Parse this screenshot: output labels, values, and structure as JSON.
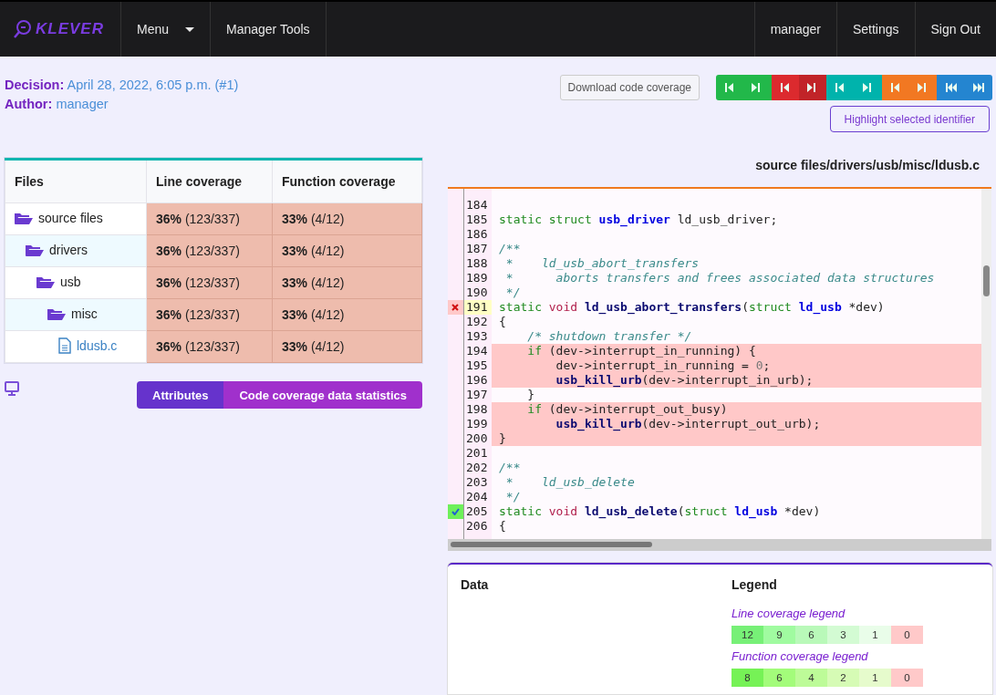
{
  "navbar": {
    "logo": "KLEVER",
    "items": [
      {
        "label": "Menu",
        "dropdown": true
      },
      {
        "label": "Manager Tools",
        "dropdown": false
      }
    ],
    "right_items": [
      "manager",
      "Settings",
      "Sign Out"
    ]
  },
  "decision": {
    "label": "Decision:",
    "value": "April 28, 2022, 6:05 p.m. (#1)"
  },
  "author": {
    "label": "Author:",
    "value": "manager"
  },
  "download_button": "Download code coverage",
  "nav_buttons": [
    {
      "kind": "prev",
      "color": "#22b84a",
      "hovered": false
    },
    {
      "kind": "next",
      "color": "#22b84a",
      "hovered": false
    },
    {
      "kind": "prev",
      "color": "#dc2a2e",
      "hovered": false
    },
    {
      "kind": "next",
      "color": "#dc2a2e",
      "hovered": true
    },
    {
      "kind": "prev",
      "color": "#00b3ac",
      "hovered": false
    },
    {
      "kind": "next",
      "color": "#00b3ac",
      "hovered": false
    },
    {
      "kind": "prev",
      "color": "#f27822",
      "hovered": false
    },
    {
      "kind": "next",
      "color": "#f27822",
      "hovered": false
    },
    {
      "kind": "first",
      "color": "#2485d0",
      "hovered": false
    },
    {
      "kind": "last",
      "color": "#2485d0",
      "hovered": false
    }
  ],
  "highlight_button": "Highlight selected identifier",
  "files_table": {
    "columns": [
      "Files",
      "Line coverage",
      "Function coverage"
    ],
    "rows": [
      {
        "name": "source files",
        "kind": "folder",
        "line_coverage": "**36%** (123/337)",
        "function_coverage": "**33%** (4/12)",
        "children": [
          {
            "name": "drivers",
            "kind": "folder",
            "line_coverage": "**36%** (123/337)",
            "function_coverage": "**33%** (4/12)",
            "children": [
              {
                "name": "usb",
                "kind": "folder",
                "line_coverage": "**36%** (123/337)",
                "function_coverage": "**33%** (4/12)",
                "children": [
                  {
                    "name": "misc",
                    "kind": "folder",
                    "line_coverage": "**36%** (123/337)",
                    "function_coverage": "**33%** (4/12)",
                    "children": [
                      {
                        "name": "ldusb.c",
                        "kind": "file",
                        "line_coverage": "**36%** (123/337)",
                        "function_coverage": "**33%** (4/12)"
                      }
                    ]
                  }
                ]
              }
            ]
          }
        ]
      }
    ]
  },
  "view_buttons": [
    {
      "label": "Attributes",
      "color": "#6633cc"
    },
    {
      "label": "Code coverage data statistics",
      "color": "#a030cc"
    }
  ],
  "file_path": "source files/drivers/usb/misc/ldusb.c",
  "code": {
    "lines": [
      {
        "number": "184",
        "uncovered": false,
        "selected": false
      },
      {
        "number": "185",
        "uncovered": false,
        "selected": false,
        "tokens": [
          {
            "kind": "kw",
            "text": "static"
          },
          {
            "kind": "kw",
            "text": " struct"
          },
          {
            "kind": "id",
            "text": " usb_driver"
          },
          {
            "kind": "plain",
            "text": " ld_usb_driver;"
          }
        ]
      },
      {
        "number": "186",
        "uncovered": false,
        "selected": false
      },
      {
        "number": "187",
        "uncovered": false,
        "selected": false,
        "tokens": [
          {
            "kind": "comment",
            "text": "/**"
          }
        ]
      },
      {
        "number": "188",
        "uncovered": false,
        "selected": false,
        "tokens": [
          {
            "kind": "comment",
            "text": " *    ld_usb_abort_transfers"
          }
        ]
      },
      {
        "number": "189",
        "uncovered": false,
        "selected": false,
        "tokens": [
          {
            "kind": "comment",
            "text": " *      aborts transfers and frees associated data structures"
          }
        ]
      },
      {
        "number": "190",
        "uncovered": false,
        "selected": false,
        "tokens": [
          {
            "kind": "comment",
            "text": " */"
          }
        ]
      },
      {
        "number": "191",
        "uncovered": false,
        "selected": true,
        "function_hit": false,
        "tokens": [
          {
            "kind": "kw",
            "text": "static"
          },
          {
            "kind": "type",
            "text": " void"
          },
          {
            "kind": "func",
            "text": " ld_usb_abort_transfers"
          },
          {
            "kind": "plain",
            "text": "("
          },
          {
            "kind": "kw",
            "text": "struct"
          },
          {
            "kind": "id",
            "text": " ld_usb"
          },
          {
            "kind": "plain",
            "text": " *dev)"
          }
        ]
      },
      {
        "number": "192",
        "uncovered": false,
        "selected": false,
        "tokens": [
          {
            "kind": "plain",
            "text": "{"
          }
        ]
      },
      {
        "number": "193",
        "uncovered": false,
        "selected": false,
        "tokens": [
          {
            "kind": "comment",
            "text": "    /* shutdown transfer */"
          }
        ]
      },
      {
        "number": "194",
        "uncovered": true,
        "selected": false,
        "tokens": [
          {
            "kind": "kw",
            "text": "    if"
          },
          {
            "kind": "plain",
            "text": " (dev->interrupt_in_running) {"
          }
        ]
      },
      {
        "number": "195",
        "uncovered": true,
        "selected": false,
        "tokens": [
          {
            "kind": "plain",
            "text": "        dev->interrupt_in_running = "
          },
          {
            "kind": "num",
            "text": "0"
          },
          {
            "kind": "plain",
            "text": ";"
          }
        ]
      },
      {
        "number": "196",
        "uncovered": true,
        "selected": false,
        "tokens": [
          {
            "kind": "func",
            "text": "        usb_kill_urb"
          },
          {
            "kind": "plain",
            "text": "(dev->interrupt_in_urb);"
          }
        ]
      },
      {
        "number": "197",
        "uncovered": false,
        "selected": false,
        "tokens": [
          {
            "kind": "plain",
            "text": "    }"
          }
        ]
      },
      {
        "number": "198",
        "uncovered": true,
        "selected": false,
        "tokens": [
          {
            "kind": "kw",
            "text": "    if"
          },
          {
            "kind": "plain",
            "text": " (dev->interrupt_out_busy)"
          }
        ]
      },
      {
        "number": "199",
        "uncovered": true,
        "selected": false,
        "tokens": [
          {
            "kind": "func",
            "text": "        usb_kill_urb"
          },
          {
            "kind": "plain",
            "text": "(dev->interrupt_out_urb);"
          }
        ]
      },
      {
        "number": "200",
        "uncovered": true,
        "selected": false,
        "tokens": [
          {
            "kind": "plain",
            "text": "}"
          }
        ]
      },
      {
        "number": "201",
        "uncovered": false,
        "selected": false
      },
      {
        "number": "202",
        "uncovered": false,
        "selected": false,
        "tokens": [
          {
            "kind": "comment",
            "text": "/**"
          }
        ]
      },
      {
        "number": "203",
        "uncovered": false,
        "selected": false,
        "tokens": [
          {
            "kind": "comment",
            "text": " *    ld_usb_delete"
          }
        ]
      },
      {
        "number": "204",
        "uncovered": false,
        "selected": false,
        "tokens": [
          {
            "kind": "comment",
            "text": " */"
          }
        ]
      },
      {
        "number": "205",
        "uncovered": false,
        "selected": false,
        "function_hit": true,
        "tokens": [
          {
            "kind": "kw",
            "text": "static"
          },
          {
            "kind": "type",
            "text": " void"
          },
          {
            "kind": "func",
            "text": " ld_usb_delete"
          },
          {
            "kind": "plain",
            "text": "("
          },
          {
            "kind": "kw",
            "text": "struct"
          },
          {
            "kind": "id",
            "text": " ld_usb"
          },
          {
            "kind": "plain",
            "text": " *dev)"
          }
        ]
      },
      {
        "number": "206",
        "uncovered": false,
        "selected": false,
        "tokens": [
          {
            "kind": "plain",
            "text": "{"
          }
        ]
      }
    ]
  },
  "data_panel": {
    "title": "Data"
  },
  "legend": {
    "title": "Legend",
    "groups": [
      {
        "title": "Line coverage legend",
        "cells": [
          {
            "text": "12",
            "color": "#77f077"
          },
          {
            "text": "9",
            "color": "#a0fba0"
          },
          {
            "text": "6",
            "color": "#b9f9b9"
          },
          {
            "text": "3",
            "color": "#d3fbd3"
          },
          {
            "text": "1",
            "color": "#e9fde9"
          },
          {
            "text": "0",
            "color": "#ffc9c9"
          }
        ]
      },
      {
        "title": "Function coverage legend",
        "cells": [
          {
            "text": "8",
            "color": "#76f256"
          },
          {
            "text": "6",
            "color": "#a3fc7a"
          },
          {
            "text": "4",
            "color": "#bdfb98"
          },
          {
            "text": "2",
            "color": "#d6fbb5"
          },
          {
            "text": "1",
            "color": "#e6fbcc"
          },
          {
            "text": "0",
            "color": "#ffc9c9"
          }
        ]
      }
    ]
  }
}
